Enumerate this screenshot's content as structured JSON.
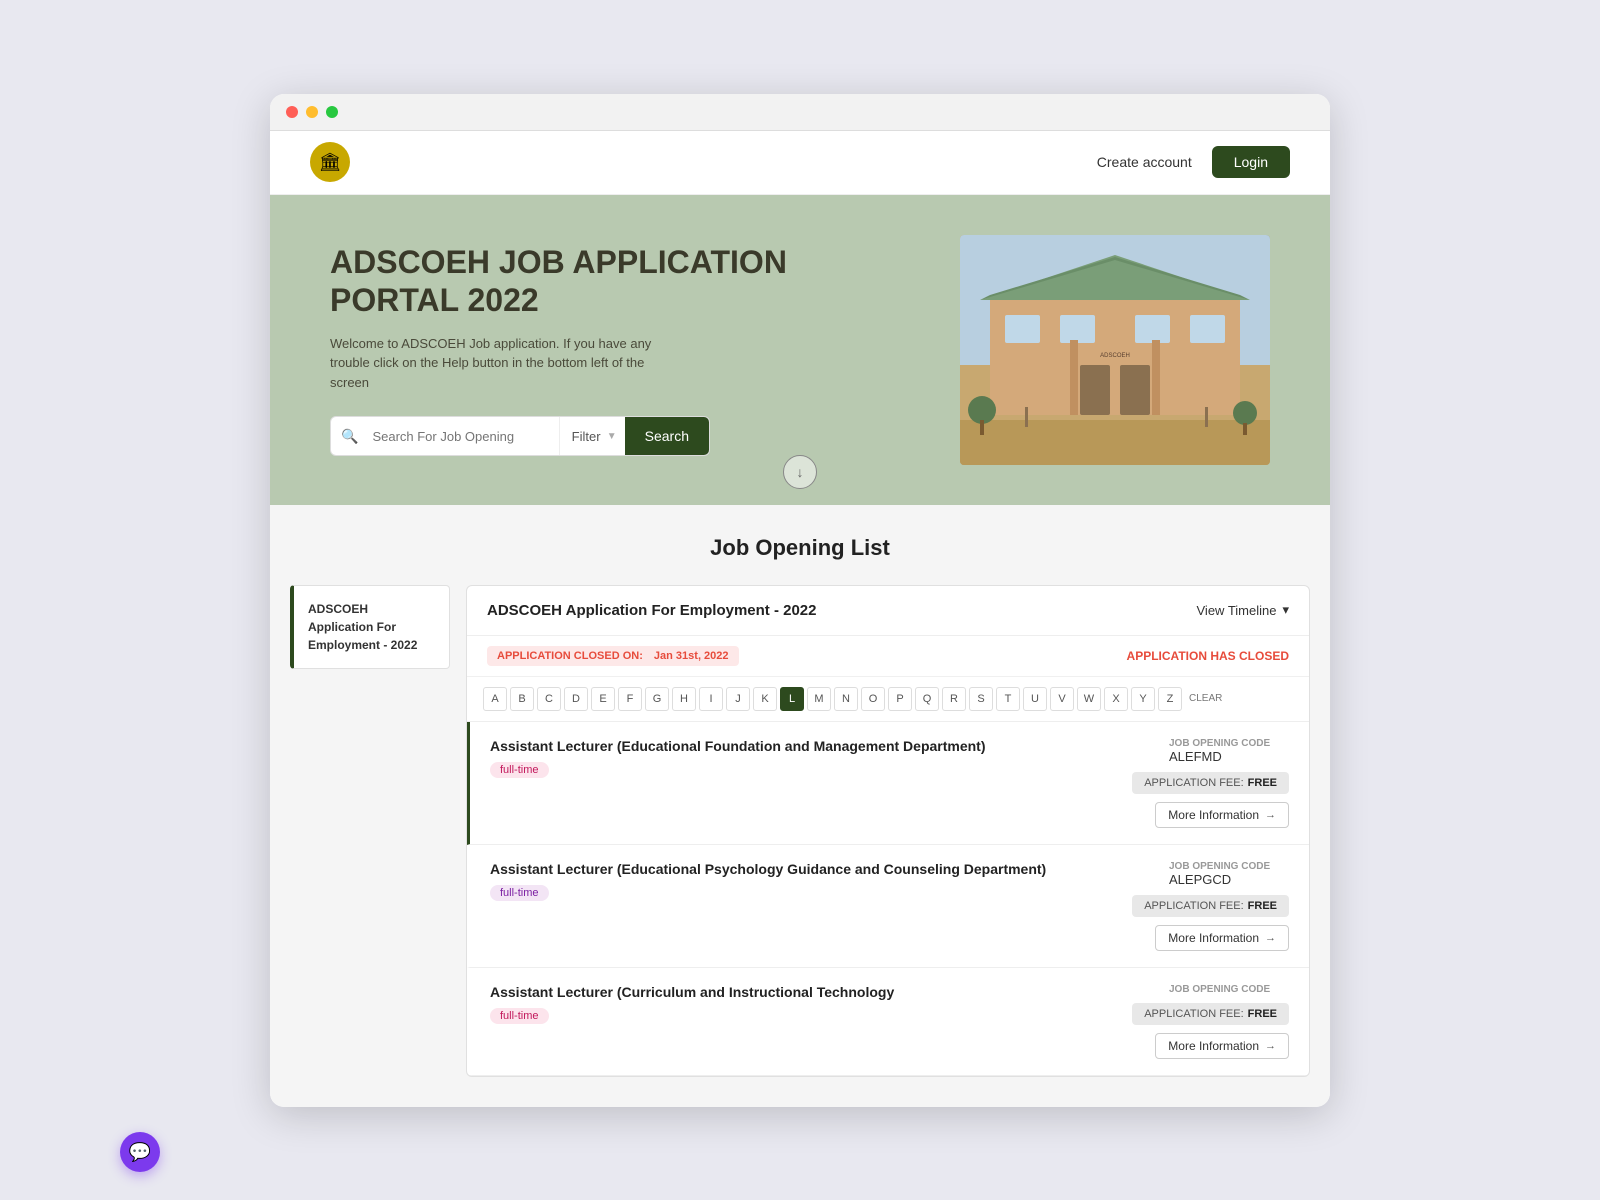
{
  "browser": {
    "dots": [
      "red",
      "yellow",
      "green"
    ]
  },
  "navbar": {
    "logo_emoji": "🏛",
    "create_account_label": "Create account",
    "login_label": "Login"
  },
  "hero": {
    "title": "ADSCOEH JOB APPLICATION PORTAL 2022",
    "subtitle": "Welcome to ADSCOEH Job application. If you have any trouble click on the Help button in the bottom left of the screen",
    "search_placeholder": "Search For Job Opening",
    "filter_label": "Filter",
    "search_btn_label": "Search",
    "scroll_icon": "↓"
  },
  "job_section": {
    "title": "Job Opening List",
    "sidebar_card_title": "ADSCOEH Application For Employment - 2022",
    "main_title": "ADSCOEH Application For Employment - 2022",
    "view_timeline_label": "View Timeline",
    "closed_badge_prefix": "APPLICATION CLOSED ON:",
    "closed_date": "Jan 31st, 2022",
    "app_closed_text": "APPLICATION HAS CLOSED",
    "alphabet": [
      "A",
      "B",
      "C",
      "D",
      "E",
      "F",
      "G",
      "H",
      "I",
      "J",
      "K",
      "L",
      "M",
      "N",
      "O",
      "P",
      "Q",
      "R",
      "S",
      "T",
      "U",
      "V",
      "W",
      "X",
      "Y",
      "Z"
    ],
    "active_letter": "L",
    "clear_label": "CLEAR",
    "jobs": [
      {
        "name": "Assistant Lecturer (Educational Foundation and Management Department)",
        "type": "full-time",
        "type_color": "pink",
        "code_label": "JOB OPENING CODE",
        "code": "ALEFMD",
        "fee_label": "APPLICATION FEE:",
        "fee_value": "FREE",
        "more_info_label": "More Information"
      },
      {
        "name": "Assistant Lecturer (Educational Psychology Guidance and Counseling Department)",
        "type": "full-time",
        "type_color": "purple",
        "code_label": "JOB OPENING CODE",
        "code": "ALEPGCD",
        "fee_label": "APPLICATION FEE:",
        "fee_value": "FREE",
        "more_info_label": "More Information"
      },
      {
        "name": "Assistant Lecturer (Curriculum and Instructional Technology",
        "type": "full-time",
        "type_color": "pink",
        "code_label": "JOB OPENING CODE",
        "code": "",
        "fee_label": "APPLICATION FEE:",
        "fee_value": "FREE",
        "more_info_label": "More Information"
      }
    ]
  },
  "chat": {
    "icon": "💬"
  }
}
